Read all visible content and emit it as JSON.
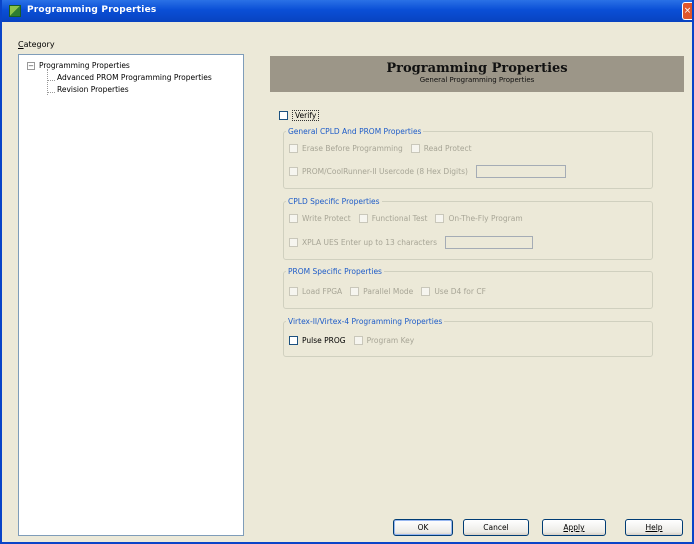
{
  "window": {
    "title": "Programming Properties",
    "close_glyph": "×"
  },
  "category": {
    "label_accel": "C",
    "label_rest": "ategory",
    "expander_glyph": "−",
    "tree": [
      "Programming Properties",
      "Advanced PROM Programming Properties",
      "Revision Properties"
    ]
  },
  "header": {
    "title": "Programming Properties",
    "subtitle": "General Programming Properties"
  },
  "verify": {
    "label": "Verify"
  },
  "general": {
    "title": "General CPLD And PROM Properties",
    "erase": "Erase Before Programming",
    "read_protect": "Read Protect",
    "usercode": "PROM/CoolRunner-II Usercode (8 Hex Digits)"
  },
  "cpld": {
    "title": "CPLD Specific Properties",
    "write_protect": "Write Protect",
    "functional_test": "Functional Test",
    "on_the_fly": "On-The-Fly Program",
    "xpla": "XPLA UES Enter up to 13 characters"
  },
  "prom": {
    "title": "PROM Specific Properties",
    "load_fpga": "Load FPGA",
    "parallel_mode": "Parallel Mode",
    "use_d4": "Use D4 for CF"
  },
  "virtex": {
    "title": "Virtex-II/Virtex-4 Programming Properties",
    "pulse_prog": "Pulse PROG",
    "program_key": "Program Key"
  },
  "buttons": {
    "ok": "OK",
    "cancel": "Cancel",
    "apply": "Apply",
    "help": "Help"
  },
  "colors": {
    "titlebar": "#0a4fd6",
    "banner": "#9c9688",
    "group_title": "#1e5cc8",
    "dialog_bg": "#ece9d8"
  }
}
